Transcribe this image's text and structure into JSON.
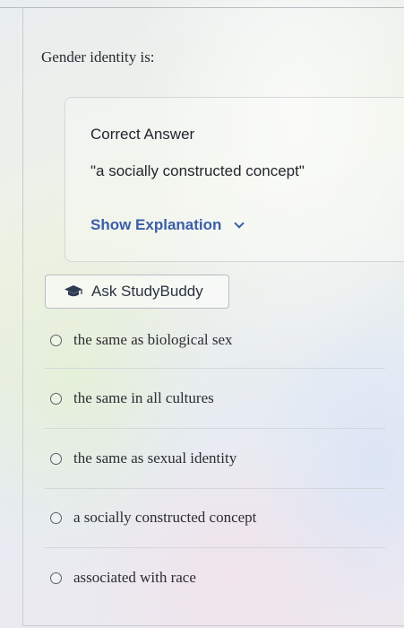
{
  "question": {
    "text": "Gender identity is:"
  },
  "answer_panel": {
    "heading": "Correct Answer",
    "answer": "\"a socially constructed concept\"",
    "explanation_toggle": "Show Explanation"
  },
  "study_buddy": {
    "label": "Ask StudyBuddy",
    "icon": "graduation-cap-icon"
  },
  "options": [
    {
      "label": "the same as biological sex"
    },
    {
      "label": "the same in all cultures"
    },
    {
      "label": "the same as sexual identity"
    },
    {
      "label": "a socially constructed concept"
    },
    {
      "label": "associated with race"
    }
  ],
  "colors": {
    "link": "#3a5ea8",
    "text": "#2b2b33"
  }
}
